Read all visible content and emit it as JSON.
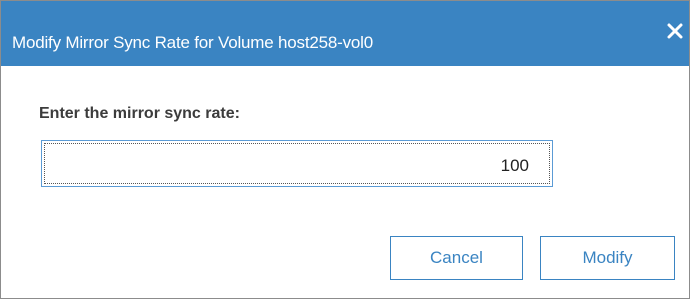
{
  "dialog": {
    "title": "Modify Mirror Sync Rate for Volume host258-vol0",
    "close_icon": "close-icon",
    "prompt": "Enter the mirror sync rate:",
    "rate_value": "100",
    "cancel_label": "Cancel",
    "modify_label": "Modify"
  },
  "colors": {
    "titlebar": "#3a84c2",
    "button_text": "#3a84c2",
    "input_border": "#5b9bd5"
  }
}
